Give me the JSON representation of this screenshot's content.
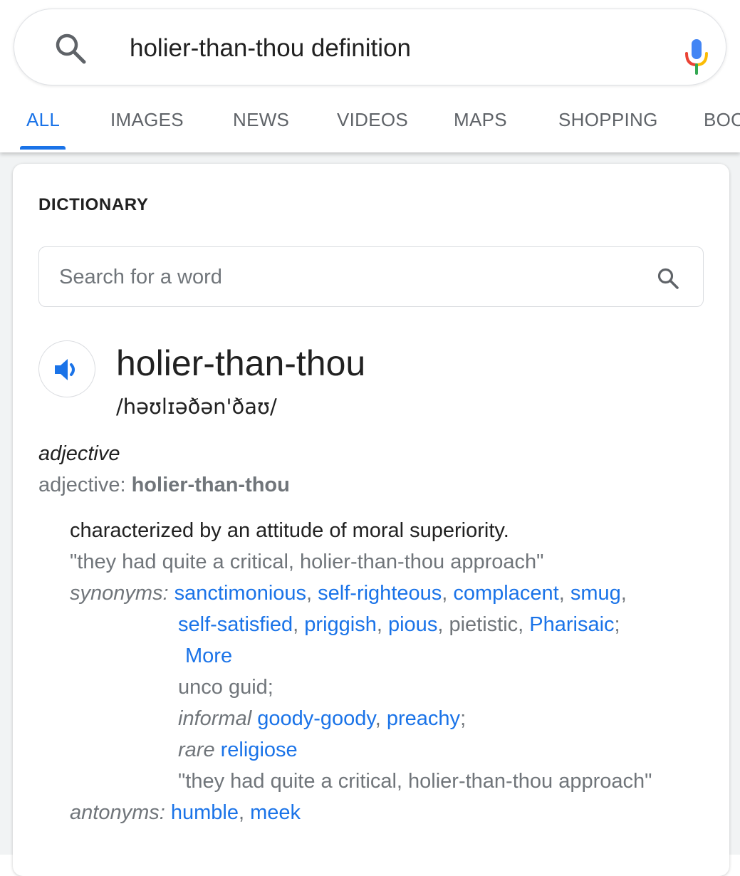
{
  "search": {
    "query": "holier-than-thou definition"
  },
  "tabs": [
    "ALL",
    "IMAGES",
    "NEWS",
    "VIDEOS",
    "MAPS",
    "SHOPPING",
    "BOO"
  ],
  "card": {
    "heading": "DICTIONARY",
    "word_search_placeholder": "Search for a word",
    "headword": "holier-than-thou",
    "phonetic": "/həʊlɪəðən'ðaʊ/",
    "part_of_speech": "adjective",
    "pos_line_label": "adjective: ",
    "pos_line_word": "holier-than-thou",
    "definition": "characterized by an attitude of moral superiority.",
    "example": "\"they had quite a critical, holier-than-thou approach\"",
    "synonyms_label": "synonyms:",
    "synonyms_row1": [
      "sanctimonious",
      "self-righteous",
      "complacent",
      "smug"
    ],
    "synonyms_row2": [
      "self-satisfied",
      "priggish",
      "pious"
    ],
    "synonyms_row2_plain": "pietistic",
    "synonyms_row2_last": "Pharisaic",
    "more_label": "More",
    "unco": "unco guid;",
    "informal_label": "informal",
    "informal_words": [
      "goody-goody",
      "preachy"
    ],
    "rare_label": "rare",
    "rare_word": "religiose",
    "example2": "\"they had quite a critical, holier-than-thou approach\"",
    "antonyms_label": "antonyms:",
    "antonyms": [
      "humble",
      "meek"
    ]
  },
  "colors": {
    "accent": "#1a73e8",
    "muted": "#70757a",
    "text": "#212121"
  },
  "icons": {
    "search": "search-icon",
    "mic": "mic-icon",
    "speaker": "speaker-icon"
  }
}
